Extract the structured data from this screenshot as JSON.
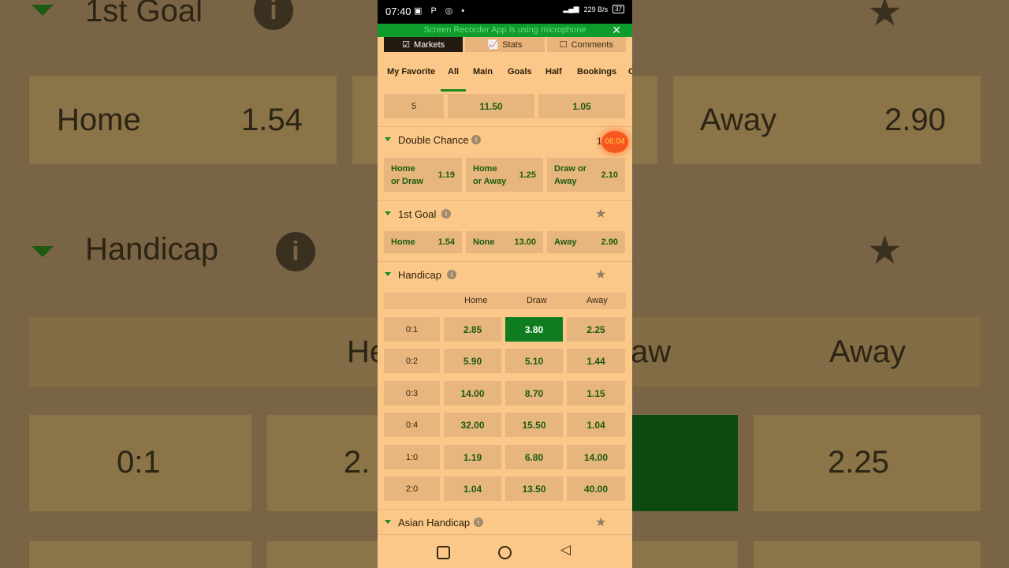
{
  "background": {
    "goal_title": "1st Goal",
    "handicap_title": "Handicap",
    "home": "Home",
    "home_odd": "1.54",
    "away": "Away",
    "away_odd": "2.90",
    "col_ho": "He",
    "col_aw": "aw",
    "col_away": "Away",
    "row_label": "0:1",
    "cell_partial": "2.",
    "cell_sel": "80",
    "cell_away": "2.25"
  },
  "status_bar": {
    "time": "07:40",
    "icons": "▣ P ◎ •",
    "net": "229 B/s",
    "battery": "37"
  },
  "recorder_banner": {
    "text": "Screen Recorder App is using microphone",
    "close": "✕"
  },
  "top_tabs": [
    {
      "label": "Markets",
      "icon": "☑"
    },
    {
      "label": "Stats",
      "icon": "📈"
    },
    {
      "label": "Comments",
      "icon": "☐"
    }
  ],
  "category_tabs": [
    "My Favorite",
    "All",
    "Main",
    "Goals",
    "Half",
    "Bookings",
    "C"
  ],
  "partial_row": [
    "5",
    "11.50",
    "1.05"
  ],
  "double_chance": {
    "title": "Double Chance",
    "partial": "1",
    "timer": "06:04",
    "options": [
      {
        "line1": "Home",
        "line2": "or Draw",
        "odd": "1.19"
      },
      {
        "line1": "Home",
        "line2": "or Away",
        "odd": "1.25"
      },
      {
        "line1": "Draw or",
        "line2": "Away",
        "odd": "2.10"
      }
    ]
  },
  "first_goal": {
    "title": "1st Goal",
    "options": [
      {
        "name": "Home",
        "odd": "1.54"
      },
      {
        "name": "None",
        "odd": "13.00"
      },
      {
        "name": "Away",
        "odd": "2.90"
      }
    ]
  },
  "handicap": {
    "title": "Handicap",
    "columns": [
      "Home",
      "Draw",
      "Away"
    ],
    "rows": [
      {
        "label": "0:1",
        "odds": [
          "2.85",
          "3.80",
          "2.25"
        ]
      },
      {
        "label": "0:2",
        "odds": [
          "5.90",
          "5.10",
          "1.44"
        ]
      },
      {
        "label": "0:3",
        "odds": [
          "14.00",
          "8.70",
          "1.15"
        ]
      },
      {
        "label": "0:4",
        "odds": [
          "32.00",
          "15.50",
          "1.04"
        ]
      },
      {
        "label": "1:0",
        "odds": [
          "1.19",
          "6.80",
          "14.00"
        ]
      },
      {
        "label": "2:0",
        "odds": [
          "1.04",
          "13.50",
          "40.00"
        ]
      }
    ]
  },
  "asian_handicap": {
    "title": "Asian Handicap"
  },
  "icons": {
    "info": "i",
    "star": "★"
  }
}
